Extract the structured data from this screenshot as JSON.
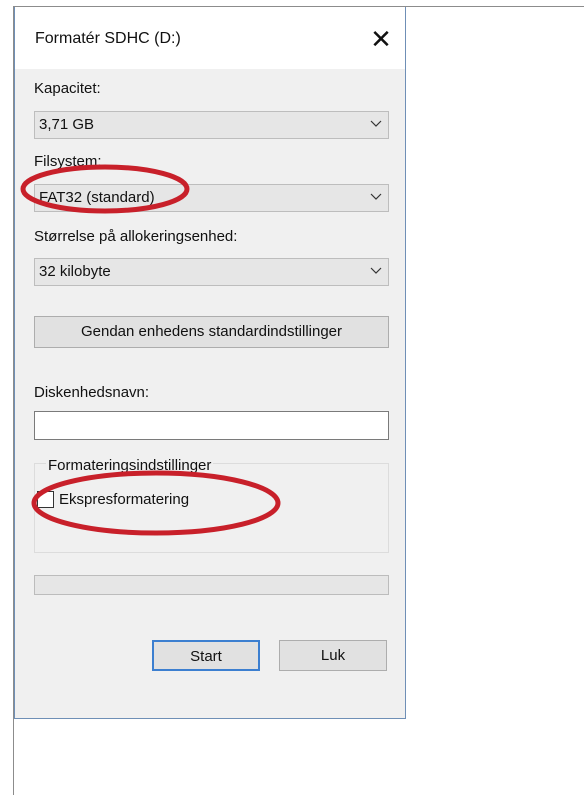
{
  "window": {
    "title": "Formatér SDHC (D:)",
    "close_symbol": "✕"
  },
  "capacity": {
    "label": "Kapacitet:",
    "value": "3,71 GB"
  },
  "filesystem": {
    "label": "Filsystem:",
    "value": "FAT32 (standard)"
  },
  "allocation": {
    "label": "Størrelse på allokeringsenhed:",
    "value": "32 kilobyte"
  },
  "restore_button": {
    "label": "Gendan enhedens standardindstillinger"
  },
  "volume": {
    "label": "Diskenhedsnavn:",
    "value": ""
  },
  "format_options": {
    "legend": "Formateringsindstillinger",
    "quick_format": {
      "label": "Ekspresformatering",
      "checked": false
    }
  },
  "progress": {
    "fraction": 0
  },
  "buttons": {
    "start": "Start",
    "close": "Luk"
  },
  "annotation_color": "#c8202a"
}
